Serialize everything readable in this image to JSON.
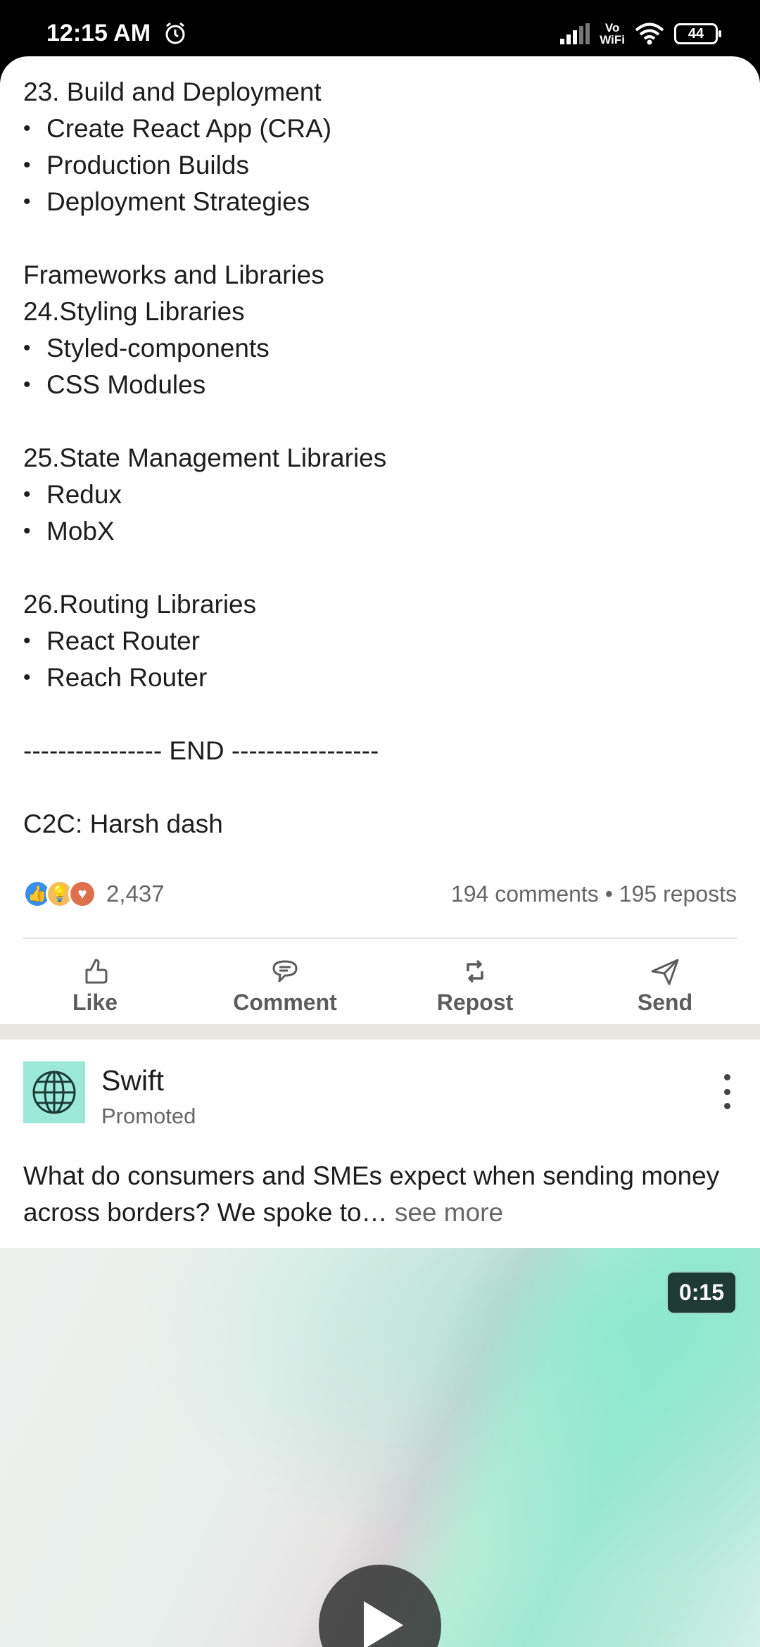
{
  "status_bar": {
    "time": "12:15 AM",
    "volte_top": "Vo",
    "volte_bottom": "WiFi",
    "battery": "44"
  },
  "post": {
    "lines": [
      {
        "text": "23. Build and Deployment",
        "bullet": false
      },
      {
        "text": "Create React App (CRA)",
        "bullet": true
      },
      {
        "text": "Production Builds",
        "bullet": true
      },
      {
        "text": "Deployment Strategies",
        "bullet": true
      },
      {
        "text": "",
        "bullet": false
      },
      {
        "text": "Frameworks and Libraries",
        "bullet": false
      },
      {
        "text": "24.Styling Libraries",
        "bullet": false
      },
      {
        "text": "Styled-components",
        "bullet": true
      },
      {
        "text": "CSS Modules",
        "bullet": true
      },
      {
        "text": "",
        "bullet": false
      },
      {
        "text": "25.State Management Libraries",
        "bullet": false
      },
      {
        "text": "Redux",
        "bullet": true
      },
      {
        "text": "MobX",
        "bullet": true
      },
      {
        "text": "",
        "bullet": false
      },
      {
        "text": "26.Routing Libraries",
        "bullet": false
      },
      {
        "text": "React Router",
        "bullet": true
      },
      {
        "text": "Reach Router",
        "bullet": true
      },
      {
        "text": "",
        "bullet": false
      },
      {
        "text": "---------------- END -----------------",
        "bullet": false
      },
      {
        "text": "",
        "bullet": false
      },
      {
        "text": "C2C: Harsh dash",
        "bullet": false
      }
    ],
    "reaction_count": "2,437",
    "reaction_icons": [
      "like-reaction-icon",
      "insightful-reaction-icon",
      "love-reaction-icon"
    ],
    "stats": "194 comments • 195 reposts",
    "actions": {
      "like": "Like",
      "comment": "Comment",
      "repost": "Repost",
      "send": "Send"
    }
  },
  "ad": {
    "name": "Swift",
    "promoted": "Promoted",
    "text": "What do consumers and SMEs expect when sending money across borders? We spoke to…",
    "see_more": "see more",
    "video_duration": "0:15",
    "logo_icon": "globe-icon"
  },
  "colors": {
    "reaction_like": "#378fe9",
    "reaction_insightful": "#f5bb5c",
    "reaction_love": "#df704d",
    "ad_logo_bg": "#9ce9da"
  }
}
